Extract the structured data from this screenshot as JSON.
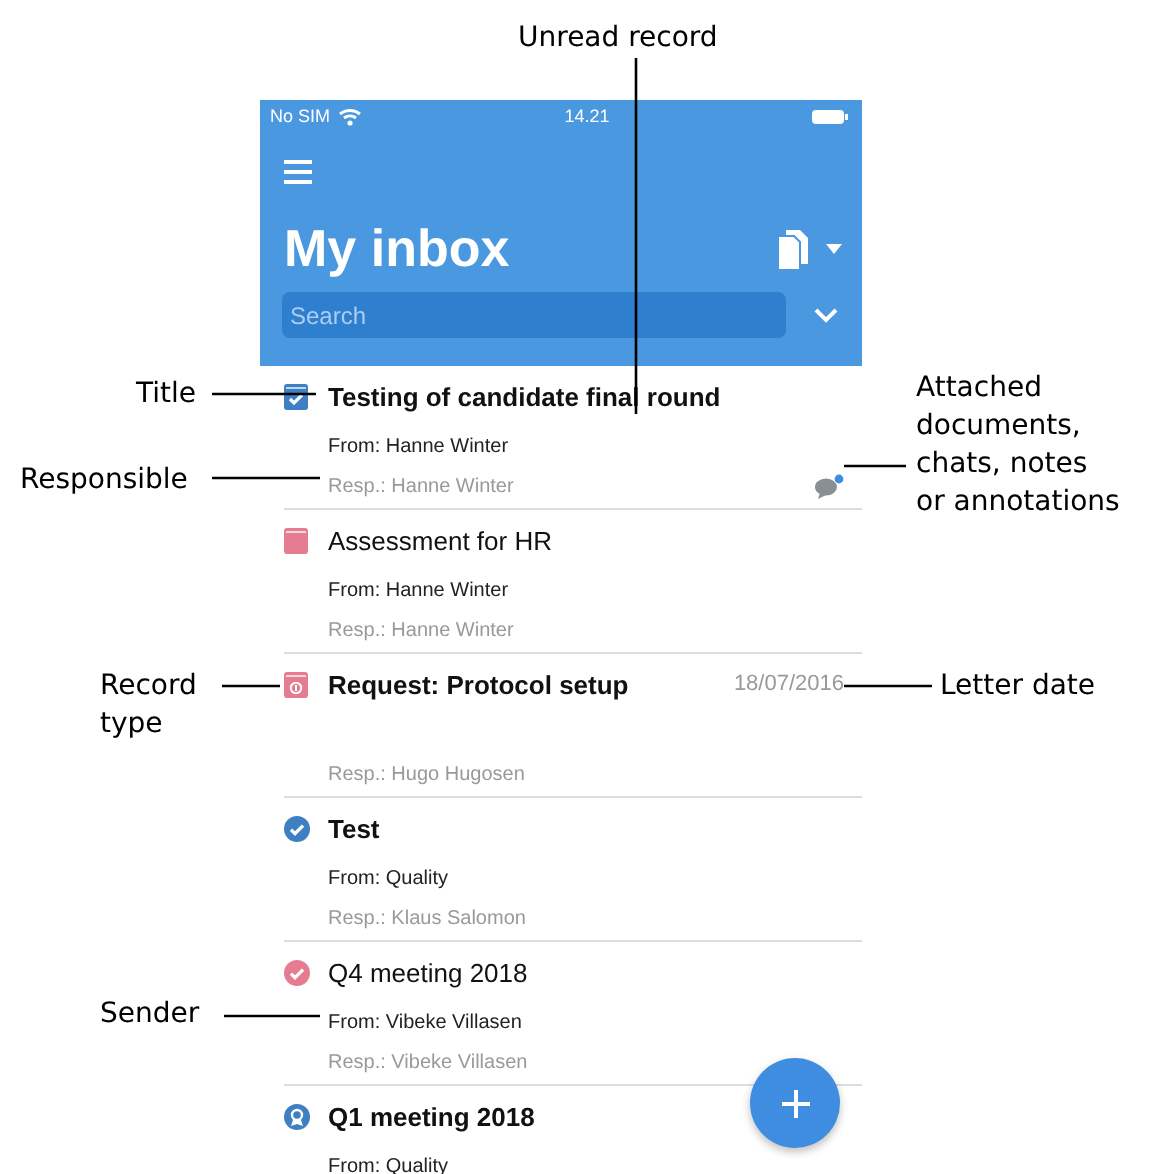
{
  "phone": {
    "status_bar": {
      "carrier": "No SIM",
      "time": "14.21"
    },
    "header": {
      "title": "My inbox",
      "search": {
        "placeholder": "Search"
      }
    },
    "records": [
      {
        "kind": "book-check",
        "color": "#3f7fc4",
        "title": "Testing of candidate final round",
        "unread": true,
        "from": "From: Hanne Winter",
        "resp": "Resp.: Hanne Winter",
        "attachments": true
      },
      {
        "kind": "book",
        "color": "#e57c92",
        "title": "Assessment for HR",
        "unread": false,
        "from": "From: Hanne Winter",
        "resp": "Resp.: Hanne Winter",
        "attachments": false
      },
      {
        "kind": "book-locked",
        "color": "#e57c92",
        "title": "Request: Protocol setup",
        "unread": true,
        "date": "18/07/2016",
        "resp": "Resp.: Hugo Hugosen",
        "attachments": false
      },
      {
        "kind": "check-circle",
        "color": "#3f7fc4",
        "title": "Test",
        "unread": true,
        "from": "From: Quality",
        "resp": "Resp.: Klaus Salomon",
        "attachments": false
      },
      {
        "kind": "check-circle",
        "color": "#e57c92",
        "title": "Q4 meeting 2018",
        "unread": false,
        "from": "From: Vibeke Villasen",
        "resp": "Resp.: Vibeke Villasen",
        "attachments": false
      },
      {
        "kind": "badge-circle",
        "color": "#3f7fc4",
        "title": "Q1 meeting 2018",
        "unread": true,
        "from": "From: Quality",
        "attachments": false
      }
    ]
  },
  "callouts": [
    {
      "text": "Unread record"
    },
    {
      "text": "Title"
    },
    {
      "text": "Responsible"
    },
    {
      "text": "Attached\ndocuments,\nchats, notes\nor annotations"
    },
    {
      "text": "Record\ntype"
    },
    {
      "text": "Letter date"
    },
    {
      "text": "Sender"
    }
  ]
}
